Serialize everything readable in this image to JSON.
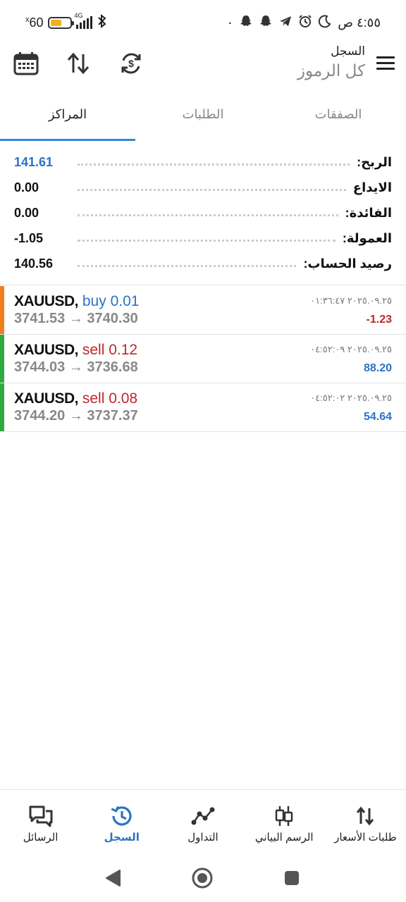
{
  "status_bar": {
    "battery_percent": "60",
    "battery_x": "x",
    "network": "4G",
    "time": "٤:٥٥ ص",
    "dot": "٠"
  },
  "header": {
    "title": "السجل",
    "subtitle": "كل الرموز"
  },
  "tabs": [
    {
      "label": "المراكز",
      "active": true
    },
    {
      "label": "الطلبات",
      "active": false
    },
    {
      "label": "الصفقات",
      "active": false
    }
  ],
  "summary": [
    {
      "label": "الربح:",
      "value": "141.61",
      "color": "#2a73c6"
    },
    {
      "label": "الايداع",
      "value": "0.00"
    },
    {
      "label": "الفائدة:",
      "value": "0.00"
    },
    {
      "label": "العمولة:",
      "value": "-1.05"
    },
    {
      "label": "رصيد الحساب:",
      "value": "140.56"
    }
  ],
  "positions": [
    {
      "symbol": "XAUUSD,",
      "type": "buy",
      "volume": "0.01",
      "open_price": "3741.53",
      "close_price": "3740.30",
      "date": "٢٠٢٥.٠٩.٢٥ ٠١:٣٦:٤٧",
      "profit": "-1.23",
      "stripe_color": "#f07f1e"
    },
    {
      "symbol": "XAUUSD,",
      "type": "sell",
      "volume": "0.12",
      "open_price": "3744.03",
      "close_price": "3736.68",
      "date": "٢٠٢٥.٠٩.٢٥ ٠٤:٥٢:٠٩",
      "profit": "88.20",
      "stripe_color": "#2eaa3f"
    },
    {
      "symbol": "XAUUSD,",
      "type": "sell",
      "volume": "0.08",
      "open_price": "3744.20",
      "close_price": "3737.37",
      "date": "٢٠٢٥.٠٩.٢٥ ٠٤:٥٢:٠٢",
      "profit": "54.64",
      "stripe_color": "#2eaa3f"
    }
  ],
  "arrow": "→",
  "bottom_nav": [
    {
      "label": "الرسائل",
      "icon": "chat-icon",
      "active": false
    },
    {
      "label": "السجل",
      "icon": "history-icon",
      "active": true
    },
    {
      "label": "التداول",
      "icon": "trade-icon",
      "active": false
    },
    {
      "label": "الرسم البياني",
      "icon": "candlestick-icon",
      "active": false
    },
    {
      "label": "طلبات الأسعار",
      "icon": "quotes-icon",
      "active": false
    }
  ],
  "colors": {
    "accent": "#2a73c6",
    "loss": "#c0262d",
    "buy_stripe": "#f07f1e",
    "sell_stripe": "#2eaa3f"
  }
}
